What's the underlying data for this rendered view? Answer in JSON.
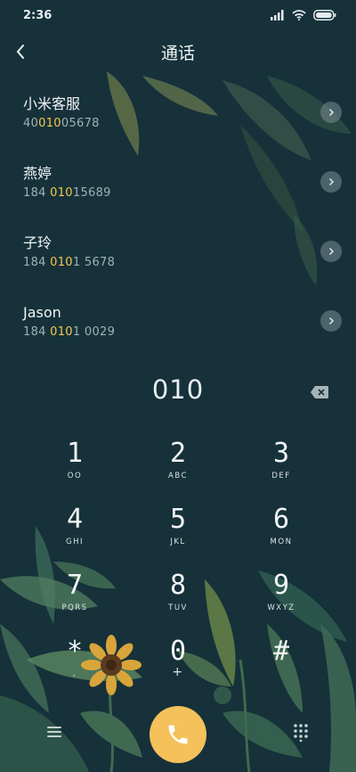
{
  "status_bar": {
    "time": "2:36"
  },
  "header": {
    "title": "通话"
  },
  "contacts": [
    {
      "name": "小米客服",
      "number_pre": "40",
      "number_match": "010",
      "number_post": "05678"
    },
    {
      "name": "燕婷",
      "number_pre": "184 ",
      "number_match": "010",
      "number_post": "15689"
    },
    {
      "name": "子玲",
      "number_pre": "184 ",
      "number_match": "010",
      "number_post": "1 5678"
    },
    {
      "name": "Jason",
      "number_pre": "184 ",
      "number_match": "010",
      "number_post": "1 0029"
    }
  ],
  "dialer": {
    "input": "010"
  },
  "keypad": [
    {
      "digit": "1",
      "letters": "OO"
    },
    {
      "digit": "2",
      "letters": "ABC"
    },
    {
      "digit": "3",
      "letters": "DEF"
    },
    {
      "digit": "4",
      "letters": "GHI"
    },
    {
      "digit": "5",
      "letters": "JKL"
    },
    {
      "digit": "6",
      "letters": "MON"
    },
    {
      "digit": "7",
      "letters": "PQRS"
    },
    {
      "digit": "8",
      "letters": "TUV"
    },
    {
      "digit": "9",
      "letters": "WXYZ"
    },
    {
      "digit": "*",
      "letters": ","
    },
    {
      "digit": "0",
      "letters": "+"
    },
    {
      "digit": "#",
      "letters": ""
    }
  ],
  "colors": {
    "background": "#16313a",
    "highlight": "#f5c84c",
    "call_button": "#f5c15b"
  }
}
